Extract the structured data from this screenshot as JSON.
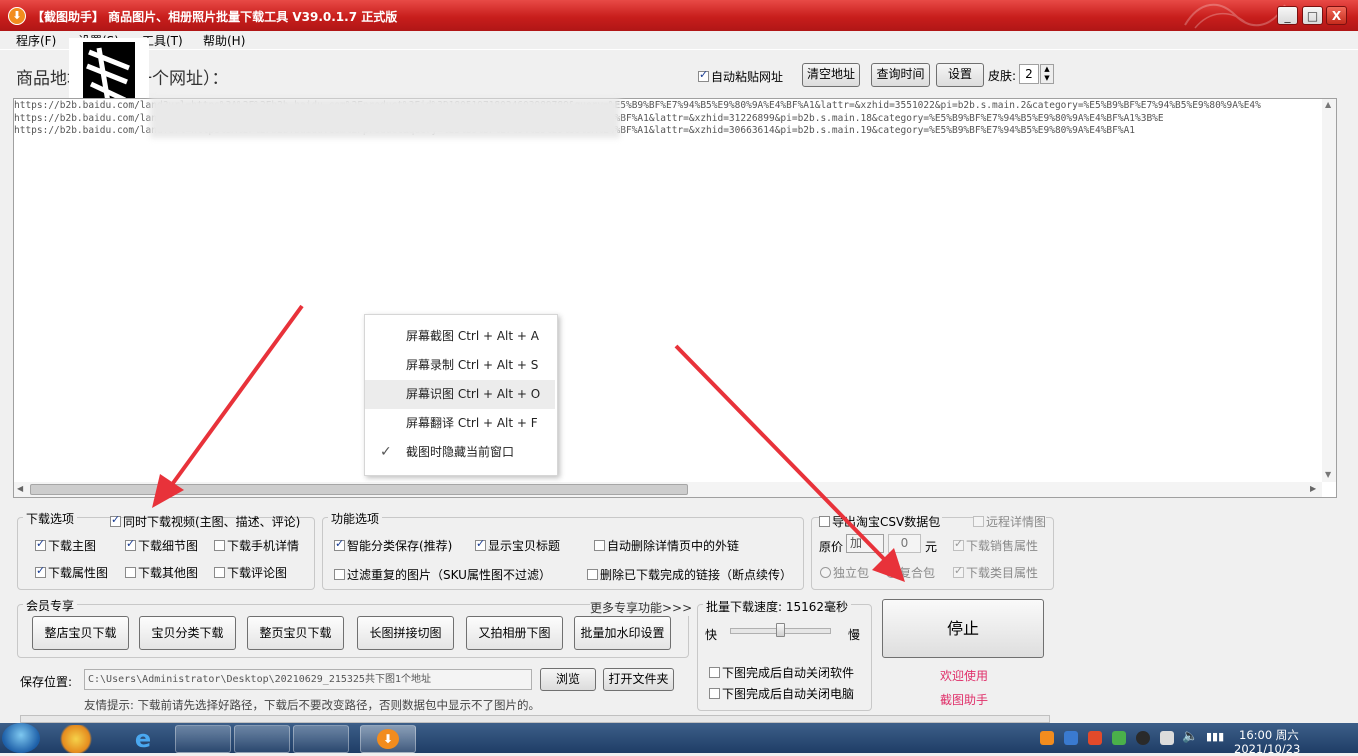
{
  "window": {
    "title": "【截图助手】 商品图片、相册照片批量下载工具 V39.0.1.7 正式版",
    "controls": [
      "_",
      "□",
      "X"
    ]
  },
  "menu": [
    "程序(F)",
    "设置(S)",
    "工具(T)",
    "帮助(H)"
  ],
  "address_label": "商品地址（每行一个网址）：",
  "toolbar": {
    "auto_paste": "自动粘贴网址",
    "clear": "清空地址",
    "query_time": "查询时间",
    "settings": "设置",
    "skin_label": "皮肤:",
    "skin_value": "2"
  },
  "urls": [
    "https://b2b.baidu.com/land?url=https%3A%2F%2Fb2b.baidu.com%2Fproduct%3Fid%3D180519718024603989789&query=%E5%B9%BF%E7%94%B5%E9%80%9A%E4%BF%A1&lattr=&xzhid=3551022&pi=b2b.s.main.2&category=%E5%B9%BF%E7%94%B5%E9%80%9A%E4%",
    "https://b2b.baidu.com/land?url=https%3A%2F%2Fb2b.baidu.com%2Fproduct&query=%E5%B9%BF%E7%94%B5%E9%80%9A%E4%BF%A1&lattr=&xzhid=31226899&pi=b2b.s.main.18&category=%E5%B9%BF%E7%94%B5%E9%80%9A%E4%BF%A1%3B%E",
    "https://b2b.baidu.com/land?url=https%3A%2F%2Fb2b.baidu.com%2Fproduct&query=%E5%B9%BF%E7%94%B5%E9%80%9A%E4%BF%A1&lattr=&xzhid=30663614&pi=b2b.s.main.19&category=%E5%B9%BF%E7%94%B5%E9%80%9A%E4%BF%A1"
  ],
  "context_menu": [
    {
      "label": "屏幕截图 Ctrl + Alt + A",
      "checked": false
    },
    {
      "label": "屏幕录制 Ctrl + Alt + S",
      "checked": false
    },
    {
      "label": "屏幕识图 Ctrl + Alt + O",
      "checked": false
    },
    {
      "label": "屏幕翻译 Ctrl + Alt + F",
      "checked": false
    },
    {
      "label": "截图时隐藏当前窗口",
      "checked": true
    }
  ],
  "download_options": {
    "title": "下载选项",
    "video": "同时下载视频(主图、描述、评论)",
    "items": [
      "下载主图",
      "下载细节图",
      "下载手机详情",
      "下载属性图",
      "下载其他图",
      "下载评论图"
    ]
  },
  "features": {
    "title": "功能选项",
    "items": [
      "智能分类保存(推荐)",
      "显示宝贝标题",
      "自动删除详情页中的外链",
      "过滤重复的图片（SKU属性图不过滤）",
      "删除已下载完成的链接（断点续传）"
    ]
  },
  "taobao": {
    "export_csv": "导出淘宝CSV数据包",
    "remote_detail": "远程详情图",
    "price_label": "原价",
    "price_op": "加",
    "price_value": "0",
    "price_unit": "元",
    "sales_attr": "下载销售属性",
    "radio_single": "独立包",
    "radio_combined": "复合包",
    "category_attr": "下载类目属性"
  },
  "member": {
    "title": "会员专享",
    "more": "更多专享功能>>>",
    "buttons": [
      "整店宝贝下载",
      "宝贝分类下载",
      "整页宝贝下载",
      "长图拼接切图",
      "又拍相册下图",
      "批量加水印设置"
    ]
  },
  "speed": {
    "label": "批量下载速度:",
    "value": "15162毫秒",
    "fast": "快",
    "slow": "慢",
    "level": 0.5,
    "close_app": "下图完成后自动关闭软件",
    "shutdown": "下图完成后自动关闭电脑"
  },
  "stop_button": "停止",
  "welcome": [
    "欢迎使用",
    "截图助手"
  ],
  "save": {
    "label": "保存位置:",
    "path": "C:\\Users\\Administrator\\Desktop\\20210629_215325共下图1个地址",
    "browse": "浏览",
    "open_folder": "打开文件夹",
    "hint": "友情提示: 下载前请先选择好路径，下载后不要改变路径，否则数据包中显示不了图片的。"
  },
  "taskbar": {
    "time": "16:00 周六",
    "date": "2021/10/23"
  },
  "colors": {
    "title_bar": "#c81e1c",
    "arrow": "#e8323a",
    "welcome": "#e0306a"
  }
}
